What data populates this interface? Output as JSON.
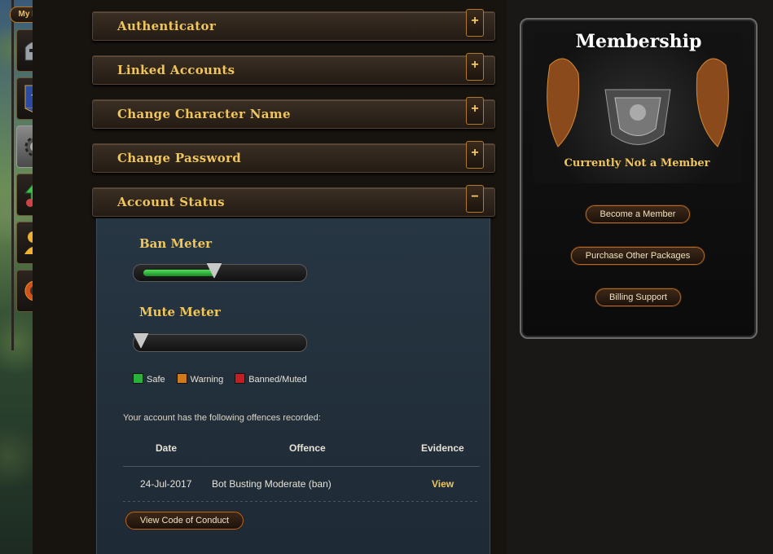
{
  "sidebar": {
    "my_info_label": "My Info",
    "items": [
      {
        "icon": "helmet-icon"
      },
      {
        "icon": "banner-icon"
      },
      {
        "icon": "gear-icon"
      },
      {
        "icon": "upgrade-arrow-icon"
      },
      {
        "icon": "add-friend-icon"
      },
      {
        "icon": "bomb-icon"
      }
    ]
  },
  "sections": {
    "authenticator": {
      "title": "Authenticator",
      "toggle": "+"
    },
    "linked_accounts": {
      "title": "Linked Accounts",
      "toggle": "+"
    },
    "change_character_name": {
      "title": "Change Character Name",
      "toggle": "+"
    },
    "change_password": {
      "title": "Change Password",
      "toggle": "+"
    },
    "account_status": {
      "title": "Account Status",
      "toggle": "−"
    }
  },
  "account_status": {
    "ban_meter": {
      "label": "Ban Meter",
      "level_pct": 48
    },
    "mute_meter": {
      "label": "Mute Meter",
      "level_pct": 0
    },
    "legend": [
      {
        "label": "Safe",
        "color": "#27b23a"
      },
      {
        "label": "Warning",
        "color": "#d07a1a"
      },
      {
        "label": "Banned/Muted",
        "color": "#c41e24"
      }
    ],
    "offences_intro": "Your account has the following offences recorded:",
    "table": {
      "headers": [
        "Date",
        "Offence",
        "Evidence"
      ],
      "rows": [
        {
          "date": "24-Jul-2017",
          "offence": "Bot Busting Moderate (ban)",
          "evidence": "View"
        }
      ]
    },
    "code_of_conduct_label": "View Code of Conduct"
  },
  "membership": {
    "title": "Membership",
    "status": "Currently Not a Member",
    "buttons": {
      "become": "Become a Member",
      "packages": "Purchase Other Packages",
      "billing": "Billing Support"
    }
  },
  "colors": {
    "accent": "#f0c55a",
    "panel_bg": "#273643"
  }
}
